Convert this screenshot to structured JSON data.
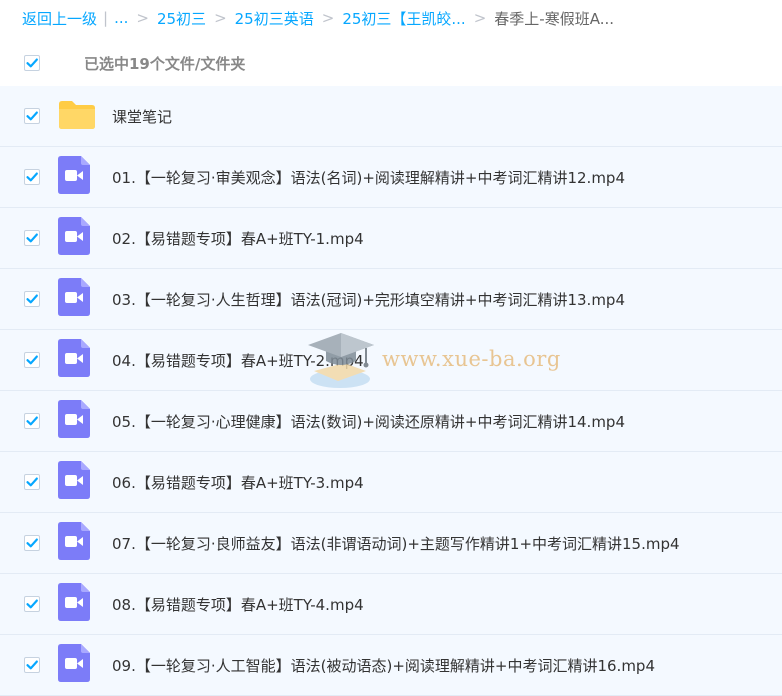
{
  "breadcrumb": {
    "back_label": "返回上一级",
    "pipe": "|",
    "ellipsis": "...",
    "sep": ">",
    "items": [
      "25初三",
      "25初三英语",
      "25初三【王凯皎..."
    ],
    "current": "春季上-寒假班A..."
  },
  "selection": {
    "text": "已选中19个文件/文件夹",
    "checked": true
  },
  "files": [
    {
      "type": "folder",
      "name": "课堂笔记",
      "checked": true
    },
    {
      "type": "video",
      "name": "01.【一轮复习·审美观念】语法(名词)+阅读理解精讲+中考词汇精讲12.mp4",
      "checked": true
    },
    {
      "type": "video",
      "name": "02.【易错题专项】春A+班TY-1.mp4",
      "checked": true
    },
    {
      "type": "video",
      "name": "03.【一轮复习·人生哲理】语法(冠词)+完形填空精讲+中考词汇精讲13.mp4",
      "checked": true
    },
    {
      "type": "video",
      "name": "04.【易错题专项】春A+班TY-2.mp4",
      "checked": true
    },
    {
      "type": "video",
      "name": "05.【一轮复习·心理健康】语法(数词)+阅读还原精讲+中考词汇精讲14.mp4",
      "checked": true
    },
    {
      "type": "video",
      "name": "06.【易错题专项】春A+班TY-3.mp4",
      "checked": true
    },
    {
      "type": "video",
      "name": "07.【一轮复习·良师益友】语法(非谓语动词)+主题写作精讲1+中考词汇精讲15.mp4",
      "checked": true
    },
    {
      "type": "video",
      "name": "08.【易错题专项】春A+班TY-4.mp4",
      "checked": true
    },
    {
      "type": "video",
      "name": "09.【一轮复习·人工智能】语法(被动语态)+阅读理解精讲+中考词汇精讲16.mp4",
      "checked": true
    }
  ],
  "watermark": {
    "text": "www.xue-ba.org",
    "icon": "graduation-cap-icon"
  },
  "colors": {
    "accent": "#06a7ff",
    "row_bg": "#f4f9ff",
    "folder": "#ffcc45",
    "video": "#7c7cf8"
  }
}
